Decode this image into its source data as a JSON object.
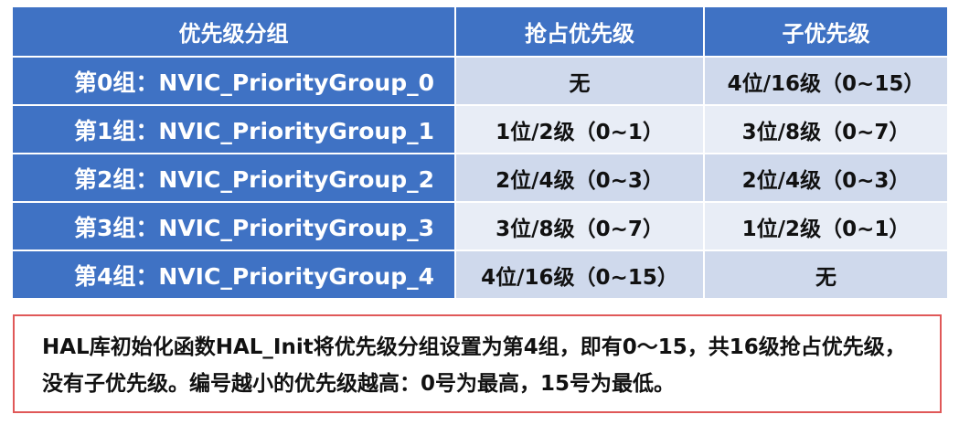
{
  "table": {
    "headers": [
      "优先级分组",
      "抢占优先级",
      "子优先级"
    ],
    "rows": [
      {
        "group": "第0组：NVIC_PriorityGroup_0",
        "preempt": "无",
        "sub": "4位/16级（0~15）"
      },
      {
        "group": "第1组：NVIC_PriorityGroup_1",
        "preempt": "1位/2级（0~1）",
        "sub": "3位/8级（0~7）"
      },
      {
        "group": "第2组：NVIC_PriorityGroup_2",
        "preempt": "2位/4级（0~3）",
        "sub": "2位/4级（0~3）"
      },
      {
        "group": "第3组：NVIC_PriorityGroup_3",
        "preempt": "3位/8级（0~7）",
        "sub": "1位/2级（0~1）"
      },
      {
        "group": "第4组：NVIC_PriorityGroup_4",
        "preempt": "4位/16级（0~15）",
        "sub": "无"
      }
    ]
  },
  "note": {
    "text": "HAL库初始化函数HAL_Init将优先级分组设置为第4组，即有0～15，共16级抢占优先级，没有子优先级。编号越小的优先级越高：0号为最高，15号为最低。"
  },
  "colors": {
    "header_bg": "#3f72c4",
    "row_odd_bg": "#cfd9ec",
    "row_even_bg": "#e8edf6",
    "note_border": "#e05858"
  }
}
